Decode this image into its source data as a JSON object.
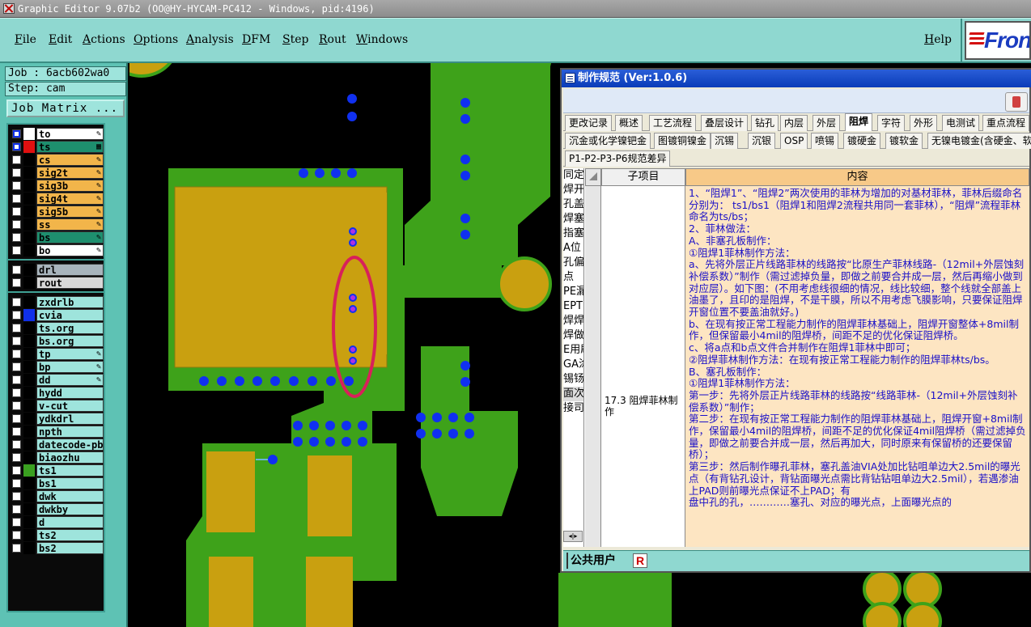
{
  "window": {
    "title": "Graphic Editor 9.07b2 (OO@HY-HYCAM-PC412 - Windows, pid:4196)"
  },
  "menu": {
    "items": [
      "File",
      "Edit",
      "Actions",
      "Options",
      "Analysis",
      "DFM",
      "Step",
      "Rout",
      "Windows"
    ],
    "help": "Help",
    "logo": "Fron"
  },
  "left_panel": {
    "job_label": "Job : 6acb602wa0",
    "step_label": "Step: cam",
    "job_matrix_button": "Job Matrix ..."
  },
  "layers": {
    "group1": [
      {
        "name": "to",
        "color": "#ffffff",
        "fill": "#ffffff",
        "checked": true,
        "polarity": "pencil"
      },
      {
        "name": "ts",
        "color": "#e01010",
        "fill": "#1e8f6e",
        "checked": true,
        "polarity": "hatched"
      },
      {
        "name": "cs",
        "color": "#000000",
        "fill": "#f2b54a",
        "checked": false,
        "polarity": "pencil"
      },
      {
        "name": "sig2t",
        "color": "#000000",
        "fill": "#f2b54a",
        "checked": false,
        "polarity": "pencil"
      },
      {
        "name": "sig3b",
        "color": "#000000",
        "fill": "#f2b54a",
        "checked": false,
        "polarity": "pencil"
      },
      {
        "name": "sig4t",
        "color": "#000000",
        "fill": "#f2b54a",
        "checked": false,
        "polarity": "pencil"
      },
      {
        "name": "sig5b",
        "color": "#000000",
        "fill": "#f2b54a",
        "checked": false,
        "polarity": "pencil"
      },
      {
        "name": "ss",
        "color": "#000000",
        "fill": "#f2b54a",
        "checked": false,
        "polarity": "pencil"
      },
      {
        "name": "bs",
        "color": "#000000",
        "fill": "#1e8f6e",
        "checked": false,
        "polarity": "pencil"
      },
      {
        "name": "bo",
        "color": "#000000",
        "fill": "#ffffff",
        "checked": false,
        "polarity": "pencil"
      }
    ],
    "group2": [
      {
        "name": "drl",
        "color": "#000000",
        "fill": "#a8b4bc",
        "checked": false,
        "polarity": ""
      },
      {
        "name": "rout",
        "color": "#000000",
        "fill": "#d8d8d8",
        "checked": false,
        "polarity": ""
      }
    ],
    "group3": [
      {
        "name": "zxdrlb",
        "color": "#000000",
        "fill": "#9ee4dc",
        "checked": false,
        "polarity": ""
      },
      {
        "name": "cvia",
        "color": "#1030e8",
        "fill": "#9ee4dc",
        "checked": false,
        "polarity": ""
      },
      {
        "name": "ts.org",
        "color": "#000000",
        "fill": "#9ee4dc",
        "checked": false,
        "polarity": ""
      },
      {
        "name": "bs.org",
        "color": "#000000",
        "fill": "#9ee4dc",
        "checked": false,
        "polarity": ""
      },
      {
        "name": "tp",
        "color": "#000000",
        "fill": "#9ee4dc",
        "checked": false,
        "polarity": "pencil"
      },
      {
        "name": "bp",
        "color": "#000000",
        "fill": "#9ee4dc",
        "checked": false,
        "polarity": "pencil"
      },
      {
        "name": "dd",
        "color": "#000000",
        "fill": "#9ee4dc",
        "checked": false,
        "polarity": "pencil"
      },
      {
        "name": "hydd",
        "color": "#000000",
        "fill": "#9ee4dc",
        "checked": false,
        "polarity": ""
      },
      {
        "name": "v-cut",
        "color": "#000000",
        "fill": "#9ee4dc",
        "checked": false,
        "polarity": ""
      },
      {
        "name": "ydkdrl",
        "color": "#000000",
        "fill": "#9ee4dc",
        "checked": false,
        "polarity": ""
      },
      {
        "name": "npth",
        "color": "#000000",
        "fill": "#9ee4dc",
        "checked": false,
        "polarity": ""
      },
      {
        "name": "datecode-pbe",
        "color": "#000000",
        "fill": "#9ee4dc",
        "checked": false,
        "polarity": ""
      },
      {
        "name": "biaozhu",
        "color": "#000000",
        "fill": "#9ee4dc",
        "checked": false,
        "polarity": ""
      },
      {
        "name": "ts1",
        "color": "#3aa020",
        "fill": "#9ee4dc",
        "checked": false,
        "polarity": ""
      },
      {
        "name": "bs1",
        "color": "#000000",
        "fill": "#9ee4dc",
        "checked": false,
        "polarity": ""
      },
      {
        "name": "dwk",
        "color": "#000000",
        "fill": "#9ee4dc",
        "checked": false,
        "polarity": ""
      },
      {
        "name": "dwkby",
        "color": "#000000",
        "fill": "#9ee4dc",
        "checked": false,
        "polarity": ""
      },
      {
        "name": "d",
        "color": "#000000",
        "fill": "#9ee4dc",
        "checked": false,
        "polarity": ""
      },
      {
        "name": "ts2",
        "color": "#000000",
        "fill": "#9ee4dc",
        "checked": false,
        "polarity": ""
      },
      {
        "name": "bs2",
        "color": "#000000",
        "fill": "#9ee4dc",
        "checked": false,
        "polarity": ""
      }
    ]
  },
  "colors": {
    "board_green": "#3ea21a",
    "copper": "#c9a010",
    "via_blue": "#1030f0",
    "highlight_ellipse": "#d8205a",
    "menu_bg": "#8fd8d0",
    "panel_bg": "#5ec2b4"
  },
  "dialog": {
    "title": "制作规范 (Ver:1.0.6)",
    "tabs_row1": [
      "更改记录",
      "概述",
      "工艺流程",
      "叠层设计",
      "钻孔",
      "内层",
      "外层",
      "阻焊",
      "字符",
      "外形",
      "电测试",
      "重点流程"
    ],
    "active_tab": "阻焊",
    "tabs_row2": [
      "沉金或化学镍钯金",
      "图镀铜镍金",
      "沉锡",
      "沉银",
      "OSP",
      "喷锡",
      "镀硬金",
      "镀软金",
      "无镍电镀金(含硬金、软"
    ],
    "tabs_row3": [
      "P1-P2-P3-P6规范差异"
    ],
    "left_tree": [
      "同定",
      "焊开",
      "孔盖",
      "焊塞",
      "指塞",
      "A位",
      "孔偏",
      "点",
      "PE漏",
      "EPTE",
      "焊焊",
      "焊做",
      "E用刷",
      "GA涂",
      "锡钖",
      "面次",
      "接司"
    ],
    "grid": {
      "col1_header": "子项目",
      "col2_header": "内容",
      "item": "17.3 阻焊菲林制作",
      "content_lines": [
        "1、“阻焊1”、“阻焊2”两次使用的菲林为增加的对基材菲林，菲林后缀命名分别为： ts1/bs1（阻焊1和阻焊2流程共用同一套菲林），“阻焊”流程菲林命名为ts/bs；",
        "2、菲林做法：",
        "A、非塞孔板制作：",
        "①阻焊1菲林制作方法：",
        "a、先将外层正片线路菲林的线路按“比原生产菲林线路-（12mil+外层蚀刻补偿系数）”制作（需过滤掉负量，即做之前要合并成一层，然后再缩小做到对应层）。如下图：(不用考虑线很细的情况，线比较细，整个线就全部盖上油墨了，且印的是阻焊，不是干膜，所以不用考虑飞膜影响，只要保证阻焊开窗位置不要盖油就好。)",
        "b、在现有按正常工程能力制作的阻焊菲林基础上，阻焊开窗整体+8mil制作，但保留最小4mil的阻焊桥，间距不足的优化保证阻焊桥。",
        "c、将a点和b点文件合并制作在阻焊1菲林中即可；",
        "②阻焊菲林制作方法：在现有按正常工程能力制作的阻焊菲林ts/bs。",
        "B、塞孔板制作：",
        "①阻焊1菲林制作方法：",
        "第一步：先将外层正片线路菲林的线路按“线路菲林-（12mil+外层蚀刻补偿系数）”制作；",
        "第二步：在现有按正常工程能力制作的阻焊菲林基础上，阻焊开窗+8mil制作，保留最小4mil的阻焊桥，间距不足的优化保证4mil阻焊桥（需过滤掉负量，即做之前要合并成一层，然后再加大，同时原来有保留桥的还要保留桥）；",
        "第三步：然后制作曝孔菲林，塞孔盖油VIA处加比钻咀单边大2.5mil的曝光点（有背钻孔设计，背钻面曝光点需比背钻钻咀单边大2.5mil），若遇渗油上PAD则前曝光点保证不上PAD；有",
        "盘中孔的孔，…………塞孔、对应的曝光点，上面曝光点的"
      ]
    },
    "status_user": "公共用户",
    "status_badge": "R"
  }
}
